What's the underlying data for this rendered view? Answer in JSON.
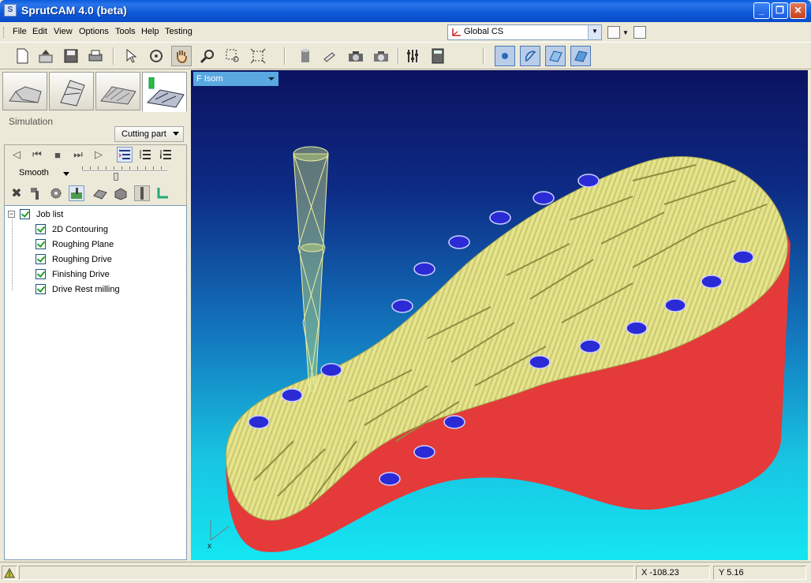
{
  "window": {
    "title": "SprutCAM 4.0 (beta)",
    "app_icon": "S",
    "controls": [
      "minimize-icon",
      "restore-icon",
      "close-icon"
    ]
  },
  "menu": {
    "items": [
      "File",
      "Edit",
      "View",
      "Options",
      "Tools",
      "Help",
      "Testing"
    ]
  },
  "coord_system": {
    "selected": "Global CS"
  },
  "toolbar": {
    "icons": [
      "new-file-icon",
      "open-file-icon",
      "save-icon",
      "print-icon",
      "pointer-icon",
      "rotate-icon",
      "pan-hand-icon",
      "zoom-icon",
      "zoom-window-icon",
      "fit-all-icon",
      "cylinder-icon",
      "flashlight-icon",
      "camera-icon",
      "camera-settings-icon",
      "sliders-icon",
      "calculator-icon",
      "point-view-icon",
      "wireframe-view-icon",
      "surface-view-icon",
      "shaded-view-icon"
    ]
  },
  "left_panel": {
    "tabs": [
      "model-tab",
      "machining-tab",
      "toolpath-tab",
      "simulation-tab"
    ],
    "section_label": "Simulation",
    "cutting_select": "Cutting part",
    "speed_mode": "Smooth",
    "speed_level": 0.4
  },
  "job_tree": {
    "root": "Job list",
    "items": [
      "2D Contouring",
      "Roughing Plane",
      "Roughing Drive",
      "Finishing Drive",
      "Drive Rest milling"
    ]
  },
  "viewport": {
    "view_name": "F Isom",
    "axis_label": "x",
    "colors": {
      "part_top": "#e6e48a",
      "part_side": "#e53a3a",
      "inserts": "#2b2bd6",
      "bg_top": "#0b1260",
      "bg_bottom": "#14e6f2"
    }
  },
  "status": {
    "x": "X -108.23",
    "y": "Y 5.16"
  }
}
